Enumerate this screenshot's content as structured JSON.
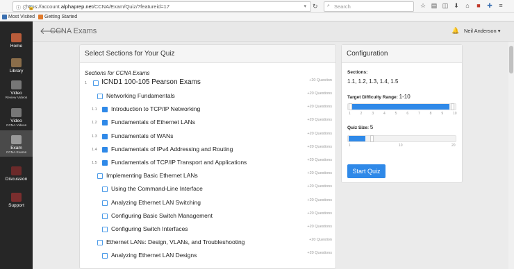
{
  "browser": {
    "url_prefix": "https://account.",
    "url_host": "alphaprep.net",
    "url_path": "/CCNA/Exam/Quiz/?featureid=17",
    "search_placeholder": "Search",
    "bookmarks": [
      "Most Visited",
      "Getting Started"
    ]
  },
  "sidebar": {
    "items": [
      {
        "label": "Home",
        "sub": ""
      },
      {
        "label": "Library",
        "sub": ""
      },
      {
        "label": "Video",
        "sub": "Review Videos"
      },
      {
        "label": "Video",
        "sub": "CCNA Videos"
      },
      {
        "label": "Exam",
        "sub": "CCNA Exams"
      },
      {
        "label": "Discussion",
        "sub": ""
      },
      {
        "label": "Support",
        "sub": ""
      }
    ]
  },
  "header": {
    "title": "CCNA Exams",
    "user": "Neil Anderson"
  },
  "sections": {
    "title": "Select Sections for Your Quiz",
    "caption": "Sections for CCNA Exams",
    "rows": [
      {
        "num": "1",
        "label": "ICND1 100-105 Pearson Exams",
        "count": "+20 Question",
        "checked": false
      },
      {
        "num": "",
        "label": "Networking Fundamentals",
        "count": "+20 Questions",
        "checked": false
      },
      {
        "num": "1.1",
        "label": "Introduction to TCP/IP Networking",
        "count": "+20 Questions",
        "checked": true
      },
      {
        "num": "1.2",
        "label": "Fundamentals of Ethernet LANs",
        "count": "+20 Questions",
        "checked": true
      },
      {
        "num": "1.3",
        "label": "Fundamentals of WANs",
        "count": "+20 Questions",
        "checked": true
      },
      {
        "num": "1.4",
        "label": "Fundamentals of IPv4 Addressing and Routing",
        "count": "+20 Questions",
        "checked": true
      },
      {
        "num": "1.5",
        "label": "Fundamentals of TCP/IP Transport and Applications",
        "count": "+20 Questions",
        "checked": true
      },
      {
        "num": "",
        "label": "Implementing Basic Ethernet LANs",
        "count": "+20 Questions",
        "checked": false
      },
      {
        "num": "",
        "label": "Using the Command-Line Interface",
        "count": "+20 Questions",
        "checked": false
      },
      {
        "num": "",
        "label": "Analyzing Ethernet LAN Switching",
        "count": "+20 Questions",
        "checked": false
      },
      {
        "num": "",
        "label": "Configuring Basic Switch Management",
        "count": "+20 Questions",
        "checked": false
      },
      {
        "num": "",
        "label": "Configuring Switch Interfaces",
        "count": "+20 Questions",
        "checked": false
      },
      {
        "num": "",
        "label": "Ethernet LANs: Design, VLANs, and Troubleshooting",
        "count": "+20 Question",
        "checked": false
      },
      {
        "num": "",
        "label": "Analyzing Ethernet LAN Designs",
        "count": "+20 Questions",
        "checked": false
      }
    ]
  },
  "config": {
    "title": "Configuration",
    "sections_label": "Sections:",
    "sections_value": "1.1, 1.2, 1.3, 1.4, 1.5",
    "difficulty_label": "Target Difficulty Range:",
    "difficulty_value": "1-10",
    "difficulty_min": 1,
    "difficulty_max": 10,
    "difficulty_ticks": [
      "1",
      "2",
      "3",
      "4",
      "5",
      "6",
      "7",
      "8",
      "9",
      "10"
    ],
    "quiz_size_label": "Quiz Size:",
    "quiz_size_value": "5",
    "quiz_size_ticks": [
      "1",
      "10",
      "20"
    ],
    "start_button": "Start Quiz"
  }
}
